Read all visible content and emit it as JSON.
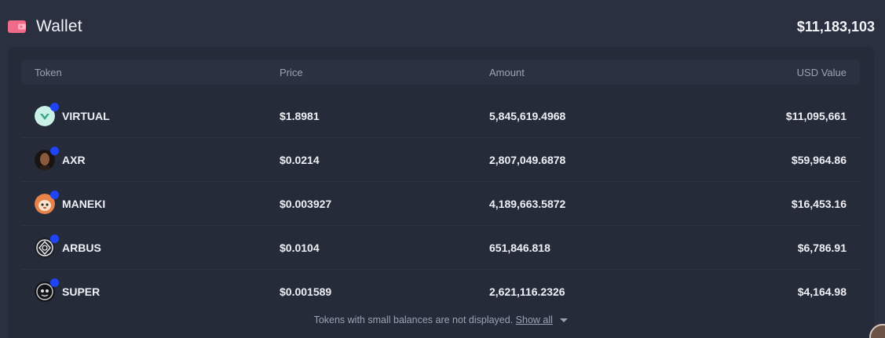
{
  "header": {
    "title": "Wallet",
    "total": "$11,183,103",
    "icon": "wallet-icon"
  },
  "table": {
    "columns": {
      "token": "Token",
      "price": "Price",
      "amount": "Amount",
      "usd_value": "USD Value"
    },
    "rows": [
      {
        "token": "VIRTUAL",
        "price": "$1.8981",
        "amount": "5,845,619.4968",
        "usd_value": "$11,095,661",
        "avatar_color": "#c9f1e6"
      },
      {
        "token": "AXR",
        "price": "$0.0214",
        "amount": "2,807,049.6878",
        "usd_value": "$59,964.86",
        "avatar_color": "#3a2a20"
      },
      {
        "token": "MANEKI",
        "price": "$0.003927",
        "amount": "4,189,663.5872",
        "usd_value": "$16,453.16",
        "avatar_color": "#e8834a"
      },
      {
        "token": "ARBUS",
        "price": "$0.0104",
        "amount": "651,846.818",
        "usd_value": "$6,786.91",
        "avatar_color": "#1c1f26"
      },
      {
        "token": "SUPER",
        "price": "$0.001589",
        "amount": "2,621,116.2326",
        "usd_value": "$4,164.98",
        "avatar_color": "#121316"
      }
    ]
  },
  "footer": {
    "note": "Tokens with small balances are not displayed.",
    "show_all": "Show all"
  },
  "colors": {
    "background": "#2b3040",
    "panel": "#262b39",
    "badge": "#1e44f5",
    "wallet_icon": "#f06a8a"
  }
}
